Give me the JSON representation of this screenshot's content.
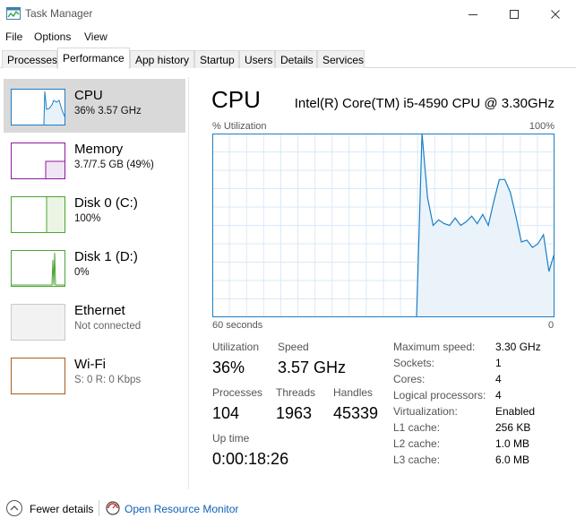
{
  "window": {
    "title": "Task Manager",
    "app_icon": "task-manager-icon"
  },
  "menu": [
    "File",
    "Options",
    "View"
  ],
  "tabs": [
    {
      "label": "Processes",
      "active": false
    },
    {
      "label": "Performance",
      "active": true
    },
    {
      "label": "App history",
      "active": false
    },
    {
      "label": "Startup",
      "active": false
    },
    {
      "label": "Users",
      "active": false
    },
    {
      "label": "Details",
      "active": false
    },
    {
      "label": "Services",
      "active": false
    }
  ],
  "sidebar": {
    "items": [
      {
        "title": "CPU",
        "subtitle": "36% 3.57 GHz",
        "selected": true,
        "color": "#1a7ec7"
      },
      {
        "title": "Memory",
        "subtitle": "3.7/7.5 GB (49%)",
        "selected": false,
        "color": "#8b1a9c"
      },
      {
        "title": "Disk 0 (C:)",
        "subtitle": "100%",
        "selected": false,
        "color": "#4da431"
      },
      {
        "title": "Disk 1 (D:)",
        "subtitle": "0%",
        "selected": false,
        "color": "#4da431"
      },
      {
        "title": "Ethernet",
        "subtitle": "Not connected",
        "selected": false,
        "color": "#c9c9c9"
      },
      {
        "title": "Wi-Fi",
        "subtitle": "S: 0 R: 0 Kbps",
        "selected": false,
        "color": "#a65d1c"
      }
    ]
  },
  "main": {
    "title": "CPU",
    "model": "Intel(R) Core(TM) i5-4590 CPU @ 3.30GHz",
    "graph_label": "% Utilization",
    "graph_max": "100%",
    "time_left": "60 seconds",
    "time_right": "0",
    "accent": "#1a7ec7",
    "stats": {
      "utilization_label": "Utilization",
      "utilization_value": "36%",
      "speed_label": "Speed",
      "speed_value": "3.57 GHz",
      "processes_label": "Processes",
      "processes_value": "104",
      "threads_label": "Threads",
      "threads_value": "1963",
      "handles_label": "Handles",
      "handles_value": "45339",
      "uptime_label": "Up time",
      "uptime_value": "0:00:18:26"
    },
    "specs": [
      {
        "label": "Maximum speed:",
        "value": "3.30 GHz"
      },
      {
        "label": "Sockets:",
        "value": "1"
      },
      {
        "label": "Cores:",
        "value": "4"
      },
      {
        "label": "Logical processors:",
        "value": "4"
      },
      {
        "label": "Virtualization:",
        "value": "Enabled"
      },
      {
        "label": "L1 cache:",
        "value": "256 KB"
      },
      {
        "label": "L2 cache:",
        "value": "1.0 MB"
      },
      {
        "label": "L3 cache:",
        "value": "6.0 MB"
      }
    ]
  },
  "chart_data": {
    "type": "area",
    "y_range": [
      0,
      100
    ],
    "x_range_seconds": [
      60,
      0
    ],
    "grid": true,
    "series": [
      {
        "values": [
          0,
          0,
          0,
          0,
          0,
          0,
          0,
          0,
          0,
          0,
          0,
          0,
          0,
          0,
          0,
          0,
          0,
          0,
          0,
          0,
          0,
          0,
          0,
          0,
          0,
          0,
          0,
          0,
          0,
          0,
          0,
          0,
          0,
          0,
          0,
          0,
          0,
          0,
          100,
          65,
          50,
          53,
          51,
          50,
          54,
          50,
          52,
          55,
          51,
          56,
          50,
          63,
          75,
          75,
          68,
          55,
          41,
          42,
          38,
          40,
          45,
          25,
          35
        ]
      }
    ]
  },
  "footer": {
    "fewer_details": "Fewer details",
    "open_resource_monitor": "Open Resource Monitor"
  }
}
